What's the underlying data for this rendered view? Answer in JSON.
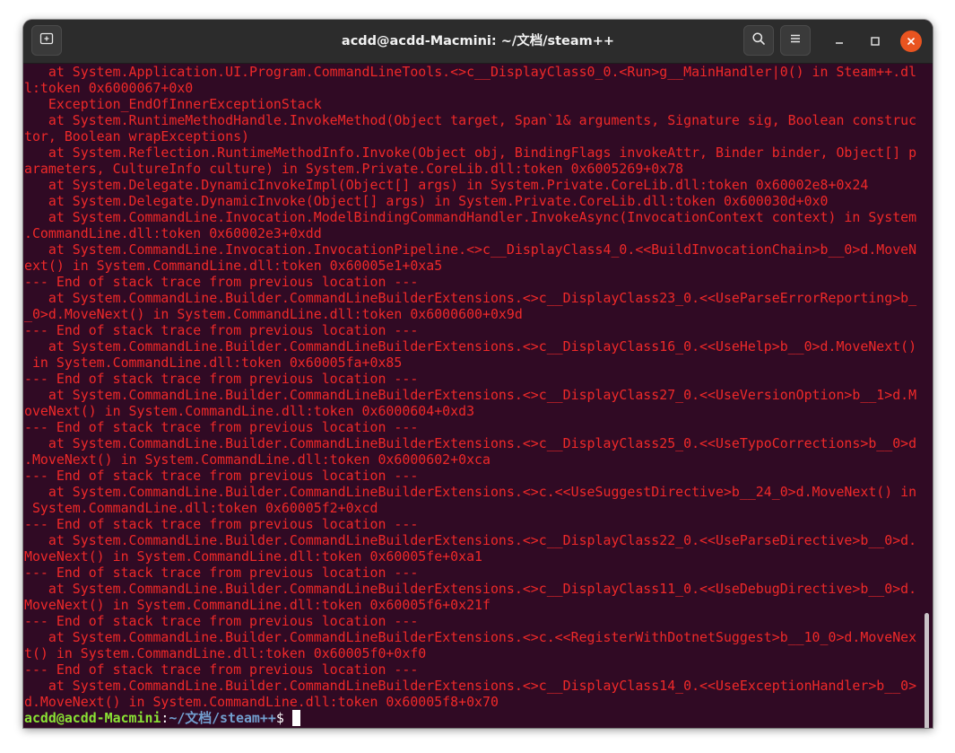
{
  "window": {
    "title": "acdd@acdd-Macmini: ~/文档/steam++"
  },
  "icons": {
    "new_tab": "new-tab-icon",
    "search": "search-icon",
    "menu": "hamburger-menu-icon",
    "minimize": "minimize-icon",
    "maximize": "maximize-icon",
    "close": "close-icon"
  },
  "colors": {
    "terminal_bg": "#300a24",
    "error_text": "#ef2929",
    "prompt_user": "#8ae234",
    "prompt_path": "#729fcf",
    "close_button": "#e95420"
  },
  "terminal": {
    "lines": [
      "   at System.Application.UI.Program.CommandLineTools.<>c__DisplayClass0_0.<Run>g__MainHandler|0() in Steam++.dl",
      "l:token 0x6000067+0x0",
      "   Exception_EndOfInnerExceptionStack",
      "   at System.RuntimeMethodHandle.InvokeMethod(Object target, Span`1& arguments, Signature sig, Boolean construc",
      "tor, Boolean wrapExceptions)",
      "   at System.Reflection.RuntimeMethodInfo.Invoke(Object obj, BindingFlags invokeAttr, Binder binder, Object[] p",
      "arameters, CultureInfo culture) in System.Private.CoreLib.dll:token 0x6005269+0x78",
      "   at System.Delegate.DynamicInvokeImpl(Object[] args) in System.Private.CoreLib.dll:token 0x60002e8+0x24",
      "   at System.Delegate.DynamicInvoke(Object[] args) in System.Private.CoreLib.dll:token 0x600030d+0x0",
      "   at System.CommandLine.Invocation.ModelBindingCommandHandler.InvokeAsync(InvocationContext context) in System",
      ".CommandLine.dll:token 0x60002e3+0xdd",
      "   at System.CommandLine.Invocation.InvocationPipeline.<>c__DisplayClass4_0.<<BuildInvocationChain>b__0>d.MoveN",
      "ext() in System.CommandLine.dll:token 0x60005e1+0xa5",
      "--- End of stack trace from previous location ---",
      "   at System.CommandLine.Builder.CommandLineBuilderExtensions.<>c__DisplayClass23_0.<<UseParseErrorReporting>b_",
      "_0>d.MoveNext() in System.CommandLine.dll:token 0x6000600+0x9d",
      "--- End of stack trace from previous location ---",
      "   at System.CommandLine.Builder.CommandLineBuilderExtensions.<>c__DisplayClass16_0.<<UseHelp>b__0>d.MoveNext()",
      " in System.CommandLine.dll:token 0x60005fa+0x85",
      "--- End of stack trace from previous location ---",
      "   at System.CommandLine.Builder.CommandLineBuilderExtensions.<>c__DisplayClass27_0.<<UseVersionOption>b__1>d.M",
      "oveNext() in System.CommandLine.dll:token 0x6000604+0xd3",
      "--- End of stack trace from previous location ---",
      "   at System.CommandLine.Builder.CommandLineBuilderExtensions.<>c__DisplayClass25_0.<<UseTypoCorrections>b__0>d",
      ".MoveNext() in System.CommandLine.dll:token 0x6000602+0xca",
      "--- End of stack trace from previous location ---",
      "   at System.CommandLine.Builder.CommandLineBuilderExtensions.<>c.<<UseSuggestDirective>b__24_0>d.MoveNext() in",
      " System.CommandLine.dll:token 0x60005f2+0xcd",
      "--- End of stack trace from previous location ---",
      "   at System.CommandLine.Builder.CommandLineBuilderExtensions.<>c__DisplayClass22_0.<<UseParseDirective>b__0>d.",
      "MoveNext() in System.CommandLine.dll:token 0x60005fe+0xa1",
      "--- End of stack trace from previous location ---",
      "   at System.CommandLine.Builder.CommandLineBuilderExtensions.<>c__DisplayClass11_0.<<UseDebugDirective>b__0>d.",
      "MoveNext() in System.CommandLine.dll:token 0x60005f6+0x21f",
      "--- End of stack trace from previous location ---",
      "   at System.CommandLine.Builder.CommandLineBuilderExtensions.<>c.<<RegisterWithDotnetSuggest>b__10_0>d.MoveNex",
      "t() in System.CommandLine.dll:token 0x60005f0+0xf0",
      "--- End of stack trace from previous location ---",
      "   at System.CommandLine.Builder.CommandLineBuilderExtensions.<>c__DisplayClass14_0.<<UseExceptionHandler>b__0>",
      "d.MoveNext() in System.CommandLine.dll:token 0x60005f8+0x70"
    ],
    "prompt": {
      "user_host": "acdd@acdd-Macmini",
      "separator": ":",
      "path": "~/文档/steam++",
      "symbol": "$ "
    }
  }
}
